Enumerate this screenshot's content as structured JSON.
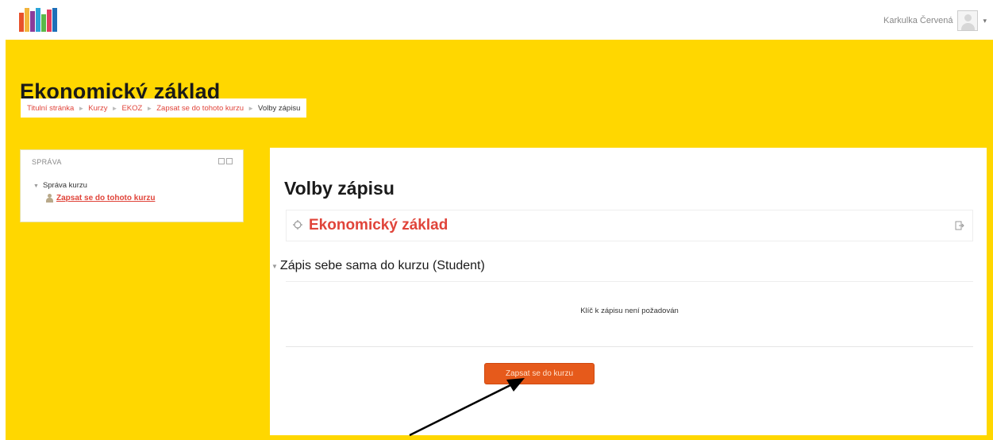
{
  "header": {
    "user_name": "Karkulka Červená",
    "caret": "▾",
    "logo_colors": [
      "#e8502a",
      "#f2b43c",
      "#8a3d9a",
      "#2aa4d8",
      "#5bb84a",
      "#e33b5e",
      "#1e6fb8"
    ]
  },
  "page": {
    "title": "Ekonomický základ",
    "breadcrumb": [
      "Titulní stránka",
      "Kurzy",
      "EKOZ",
      "Zapsat se do tohoto kurzu",
      "Volby zápisu"
    ],
    "separator": "►"
  },
  "sidebar": {
    "block_title": "SPRÁVA",
    "tree_toggle": "▼",
    "item_label": "Správa kurzu",
    "subitem_label": "Zapsat se do tohoto kurzu"
  },
  "main": {
    "heading": "Volby zápisu",
    "course_name": "Ekonomický základ",
    "section_toggle": "▼",
    "section_title": "Zápis sebe sama do kurzu (Student)",
    "key_text": "Klíč k zápisu není požadován",
    "enrol_button": "Zapsat se do kurzu"
  },
  "colors": {
    "accent_yellow": "#ffd700",
    "link_red": "#e0443a",
    "button_orange": "#e65a1b"
  }
}
